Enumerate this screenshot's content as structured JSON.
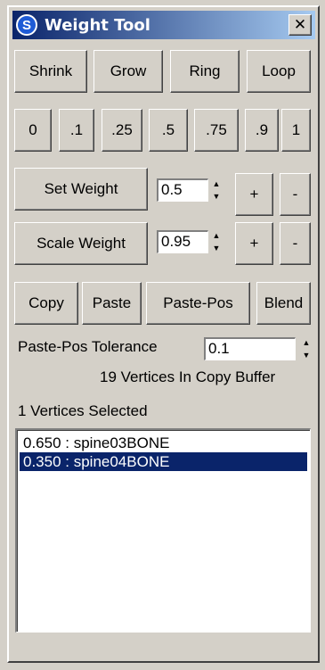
{
  "window": {
    "title": "Weight Tool",
    "close_glyph": "✕",
    "icon": "app-logo-icon"
  },
  "selection_buttons": [
    "Shrink",
    "Grow",
    "Ring",
    "Loop"
  ],
  "preset_buttons": [
    "0",
    ".1",
    ".25",
    ".5",
    ".75",
    ".9",
    "1"
  ],
  "set_weight": {
    "label": "Set Weight",
    "value": "0.5",
    "plus": "+",
    "minus": "-"
  },
  "scale_weight": {
    "label": "Scale Weight",
    "value": "0.95",
    "plus": "+",
    "minus": "-"
  },
  "clipboard_buttons": [
    "Copy",
    "Paste",
    "Paste-Pos",
    "Blend"
  ],
  "tolerance": {
    "label": "Paste-Pos Tolerance",
    "value": "0.1"
  },
  "copy_buffer_status": "19 Vertices In Copy Buffer",
  "selection_status": "1 Vertices Selected",
  "bone_list": {
    "items": [
      "0.650 : spine03BONE",
      "0.350 : spine04BONE"
    ],
    "selected_index": 1
  },
  "colors": {
    "selection": "#0a246a",
    "title_gradient_start": "#0a246a",
    "title_gradient_end": "#a6caf0"
  }
}
